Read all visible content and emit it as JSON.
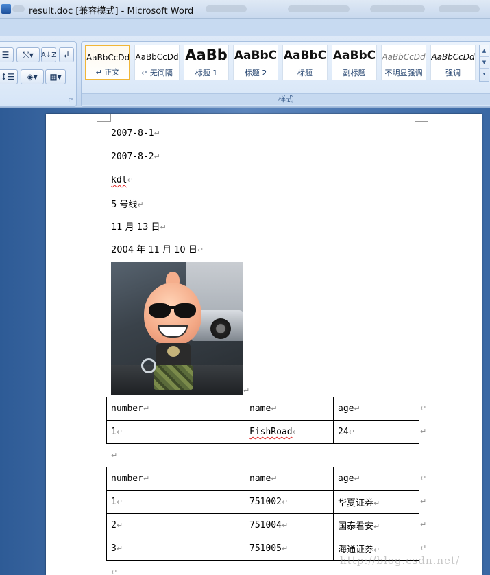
{
  "window": {
    "title": "result.doc [兼容模式] - Microsoft Word"
  },
  "ribbon": {
    "styles_group_label": "样式",
    "styles": [
      {
        "preview": "AaBbCcDd",
        "name": "↵ 正文",
        "active": true
      },
      {
        "preview": "AaBbCcDd",
        "name": "↵ 无间隔",
        "active": false
      },
      {
        "preview": "AaBb",
        "name": "标题 1",
        "active": false
      },
      {
        "preview": "AaBbC",
        "name": "标题 2",
        "active": false
      },
      {
        "preview": "AaBbC",
        "name": "标题",
        "active": false
      },
      {
        "preview": "AaBbC",
        "name": "副标题",
        "active": false
      },
      {
        "preview": "AaBbCcDd",
        "name": "不明显强调",
        "active": false
      },
      {
        "preview": "AaBbCcDd",
        "name": "强调",
        "active": false
      }
    ]
  },
  "document": {
    "paragraph_mark": "↵",
    "paragraphs": [
      "2007-8-1",
      "2007-8-2",
      "kdl",
      "5 号线",
      "11 月 13 日",
      "2004 年 11 月 10 日"
    ],
    "table1": {
      "header": [
        "number",
        "name",
        "age"
      ],
      "rows": [
        [
          "1",
          "FishRoad",
          "24"
        ]
      ]
    },
    "table2": {
      "header": [
        "number",
        "name",
        "age"
      ],
      "rows": [
        [
          "1",
          "751002",
          "华夏证券"
        ],
        [
          "2",
          "751004",
          "国泰君安"
        ],
        [
          "3",
          "751005",
          "海通证券"
        ]
      ]
    }
  },
  "watermark": "http://blog.csdn.net/"
}
